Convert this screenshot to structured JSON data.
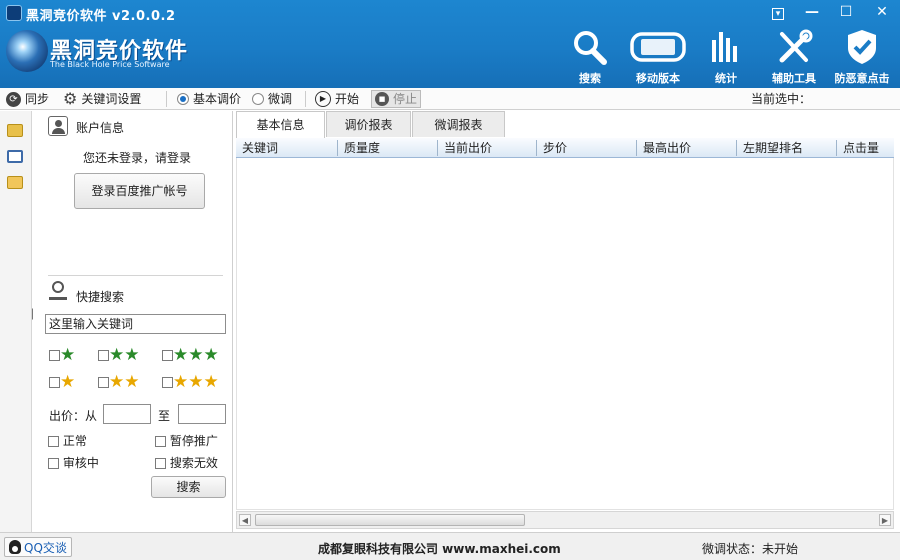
{
  "app": {
    "title": "黑洞竞价软件 v2.0.0.2",
    "logo_cn": "黑洞竞价软件",
    "logo_en": "The Black Hole Price Software"
  },
  "window_controls": {
    "menu": "▾",
    "minimize": "—",
    "maximize": "☐",
    "close": "✕"
  },
  "tools": [
    {
      "label": "搜索",
      "icon": "search-icon"
    },
    {
      "label": "移动版本",
      "icon": "mobile-device-icon"
    },
    {
      "label": "统计",
      "icon": "bar-stats-icon"
    },
    {
      "label": "辅助工具",
      "icon": "tools-icon"
    },
    {
      "label": "防恶意点击",
      "icon": "shield-check-icon"
    }
  ],
  "toolbar": {
    "sync": "同步",
    "keyword_settings": "关键词设置",
    "mode_basic": "基本调价",
    "mode_micro": "微调",
    "start": "开始",
    "stop": "停止",
    "current_selected": "当前选中："
  },
  "account": {
    "title": "账户信息",
    "not_logged_in": "您还未登录，请登录",
    "login_button": "登录百度推广帐号"
  },
  "quick_search": {
    "title": "快捷搜索",
    "keyword_value": "这里输入关键词",
    "bid_label": "出价：从",
    "to_label": "至",
    "from_value": "",
    "to_value": "",
    "status_normal": "正常",
    "status_paused": "暂停推广",
    "status_review": "审核中",
    "status_invalid": "搜索无效",
    "search_button": "搜索"
  },
  "tabs": [
    "基本信息",
    "调价报表",
    "微调报表"
  ],
  "columns": [
    "关键词",
    "质量度",
    "当前出价",
    "步价",
    "最高出价",
    "左期望排名",
    "点击量"
  ],
  "status": {
    "qq": "QQ交谈",
    "company": "成都复眼科技有限公司 www.maxhei.com",
    "micro_status": "微调状态：未开始"
  },
  "colors": {
    "title_bar": "#1a7cc6",
    "grid_header": "#dbe8f5",
    "green_star": "#2a8a2a",
    "yellow_star": "#e8a700"
  }
}
